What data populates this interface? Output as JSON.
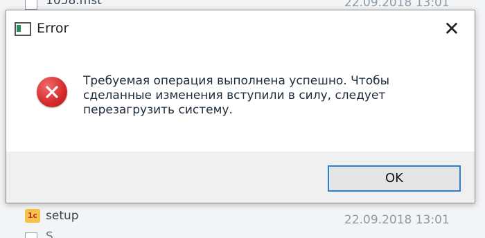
{
  "background": {
    "top_file": {
      "name": "1058.mst",
      "date": "22.09.2018 13:01"
    },
    "setup_file": {
      "name": "setup",
      "date": "22.09.2018 13:01",
      "icon_label": "1c"
    },
    "partial_file": {
      "name": "S..."
    }
  },
  "dialog": {
    "title": "Error",
    "message": "Требуемая операция выполнена успешно. Чтобы сделанные изменения вступили в силу, следует перезагрузить систему.",
    "ok_label": "OK",
    "icons": {
      "app": "app-window-icon",
      "error": "error-icon",
      "close": "close-icon"
    },
    "colors": {
      "error_red": "#d42a2a",
      "focus_blue": "#2b7fd8",
      "footer_gray": "#f0f0f0"
    }
  }
}
